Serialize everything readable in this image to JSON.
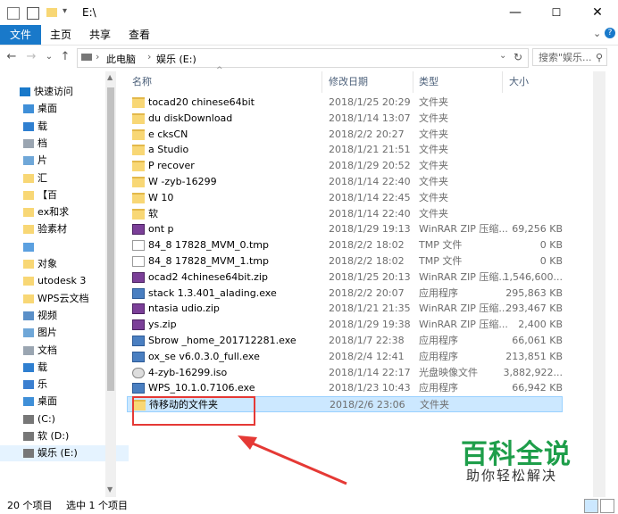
{
  "window": {
    "title": "E:\\",
    "minimize": "—",
    "maximize": "☐",
    "close": "✕"
  },
  "ribbon": {
    "tabs": [
      "文件",
      "主页",
      "共享",
      "查看"
    ]
  },
  "navbar": {
    "back": "←",
    "forward": "→",
    "recent": "⌄",
    "up": "↑",
    "breadcrumb": [
      "此电脑",
      "娱乐 (E:)"
    ],
    "refresh": "↻",
    "search_placeholder": "搜索\"娱乐...",
    "search_icon": "⚲"
  },
  "nav_pane": {
    "items": [
      {
        "label": "快速访问",
        "icon": "star-icon"
      },
      {
        "label": "桌面",
        "icon": "desktop-icon"
      },
      {
        "label": "载",
        "icon": "download-icon"
      },
      {
        "label": "档",
        "icon": "document-icon"
      },
      {
        "label": "片",
        "icon": "picture-icon"
      },
      {
        "label": "汇",
        "icon": "folder-icon"
      },
      {
        "label": "【百",
        "icon": "folder-icon"
      },
      {
        "label": "ex和求",
        "icon": "folder-icon"
      },
      {
        "label": "验素材",
        "icon": "folder-icon"
      },
      {
        "label": "",
        "icon": "cloud-icon"
      },
      {
        "label": "对象",
        "icon": "folder-icon"
      },
      {
        "label": "utodesk 3",
        "icon": "folder-icon"
      },
      {
        "label": "WPS云文档",
        "icon": "folder-icon"
      },
      {
        "label": "视频",
        "icon": "video-icon"
      },
      {
        "label": "图片",
        "icon": "picture-icon"
      },
      {
        "label": "文档",
        "icon": "document-icon"
      },
      {
        "label": "载",
        "icon": "download-icon"
      },
      {
        "label": "乐",
        "icon": "music-icon"
      },
      {
        "label": "桌面",
        "icon": "desktop-icon"
      },
      {
        "label": "(C:)",
        "icon": "drive-icon"
      },
      {
        "label": "软 (D:)",
        "icon": "drive-icon"
      },
      {
        "label": "娱乐 (E:)",
        "icon": "drive-icon"
      }
    ]
  },
  "columns": {
    "name": "名称",
    "date": "修改日期",
    "type": "类型",
    "size": "大小"
  },
  "files": [
    {
      "name": "tocad20 chinese64bit",
      "date": "2018/1/25 20:29",
      "type": "文件夹",
      "size": "",
      "icon": "folder"
    },
    {
      "name": "du diskDownload",
      "date": "2018/1/14 13:07",
      "type": "文件夹",
      "size": "",
      "icon": "folder"
    },
    {
      "name": "e cksCN",
      "date": "2018/2/2 20:27",
      "type": "文件夹",
      "size": "",
      "icon": "folder"
    },
    {
      "name": "a Studio",
      "date": "2018/1/21 21:51",
      "type": "文件夹",
      "size": "",
      "icon": "folder"
    },
    {
      "name": "P recover",
      "date": "2018/1/29 20:52",
      "type": "文件夹",
      "size": "",
      "icon": "folder"
    },
    {
      "name": "W -zyb-16299",
      "date": "2018/1/14 22:40",
      "type": "文件夹",
      "size": "",
      "icon": "folder"
    },
    {
      "name": "W 10",
      "date": "2018/1/14 22:45",
      "type": "文件夹",
      "size": "",
      "icon": "folder"
    },
    {
      "name": "软",
      "date": "2018/1/14 22:40",
      "type": "文件夹",
      "size": "",
      "icon": "folder"
    },
    {
      "name": "ont p",
      "date": "2018/1/29 19:13",
      "type": "WinRAR ZIP 压缩...",
      "size": "69,256 KB",
      "icon": "zip"
    },
    {
      "name": "84_8 17828_MVM_0.tmp",
      "date": "2018/2/2 18:02",
      "type": "TMP 文件",
      "size": "0 KB",
      "icon": "doc"
    },
    {
      "name": "84_8 17828_MVM_1.tmp",
      "date": "2018/2/2 18:02",
      "type": "TMP 文件",
      "size": "0 KB",
      "icon": "doc"
    },
    {
      "name": "ocad2 4chinese64bit.zip",
      "date": "2018/1/25 20:13",
      "type": "WinRAR ZIP 压缩...",
      "size": "1,546,600...",
      "icon": "zip"
    },
    {
      "name": "stack 1.3.401_alading.exe",
      "date": "2018/2/2 20:07",
      "type": "应用程序",
      "size": "295,863 KB",
      "icon": "exe"
    },
    {
      "name": "ntasia udio.zip",
      "date": "2018/1/21 21:35",
      "type": "WinRAR ZIP 压缩...",
      "size": "293,467 KB",
      "icon": "zip"
    },
    {
      "name": "ys.zip",
      "date": "2018/1/29 19:38",
      "type": "WinRAR ZIP 压缩...",
      "size": "2,400 KB",
      "icon": "zip"
    },
    {
      "name": "Sbrow _home_201712281.exe",
      "date": "2018/1/7 22:38",
      "type": "应用程序",
      "size": "66,061 KB",
      "icon": "exe"
    },
    {
      "name": "ox_se v6.0.3.0_full.exe",
      "date": "2018/2/4 12:41",
      "type": "应用程序",
      "size": "213,851 KB",
      "icon": "exe"
    },
    {
      "name": "4-zyb-16299.iso",
      "date": "2018/1/14 22:17",
      "type": "光盘映像文件",
      "size": "3,882,922...",
      "icon": "iso"
    },
    {
      "name": "WPS_10.1.0.7106.exe",
      "date": "2018/1/23 10:43",
      "type": "应用程序",
      "size": "66,942 KB",
      "icon": "exe"
    },
    {
      "name": "待移动的文件夹",
      "date": "2018/2/6 23:06",
      "type": "文件夹",
      "size": "",
      "icon": "folder"
    }
  ],
  "status": {
    "item_count": "20 个项目",
    "selected": "选中 1 个项目"
  },
  "watermark": {
    "main": "百科全说",
    "sub": "助你轻松解决"
  }
}
